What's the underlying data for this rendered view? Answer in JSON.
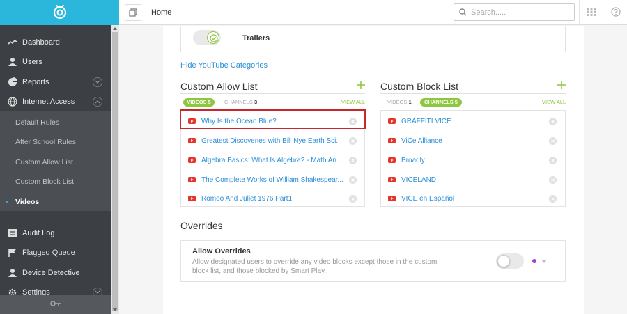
{
  "topbar": {
    "breadcrumb": "Home",
    "search_placeholder": "Search....."
  },
  "sidebar": {
    "items": [
      {
        "label": "Dashboard",
        "icon": "chart-line-icon"
      },
      {
        "label": "Users",
        "icon": "user-icon"
      },
      {
        "label": "Reports",
        "icon": "pie-chart-icon"
      },
      {
        "label": "Internet Access",
        "icon": "globe-icon"
      }
    ],
    "subitems": [
      {
        "label": "Default Rules"
      },
      {
        "label": "After School Rules"
      },
      {
        "label": "Custom Allow List"
      },
      {
        "label": "Custom Block List"
      },
      {
        "label": "Videos"
      }
    ],
    "items_bottom": [
      {
        "label": "Audit Log",
        "icon": "list-icon"
      },
      {
        "label": "Flagged Queue",
        "icon": "flag-icon"
      },
      {
        "label": "Device Detective",
        "icon": "user-icon"
      },
      {
        "label": "Settings",
        "icon": "gear-icon"
      }
    ]
  },
  "trailers": {
    "label": "Trailers"
  },
  "hide_categories": "Hide YouTube Categories",
  "allow_list": {
    "title": "Custom Allow List",
    "tab_videos_label": "VIDEOS",
    "tab_videos_count": "5",
    "tab_channels_label": "CHANNELS",
    "tab_channels_count": "3",
    "view_all": "VIEW ALL",
    "items": [
      "Why Is the Ocean Blue?",
      "Greatest Discoveries with Bill Nye Earth Sci...",
      "Algebra Basics: What Is Algebra? - Math An...",
      "The Complete Works of William Shakespear...",
      "Romeo And Juliet 1976 Part1"
    ]
  },
  "block_list": {
    "title": "Custom Block List",
    "tab_videos_label": "VIDEOS",
    "tab_videos_count": "1",
    "tab_channels_label": "CHANNELS",
    "tab_channels_count": "5",
    "view_all": "VIEW ALL",
    "items": [
      "GRAFFITI VICE",
      "ViCe Alliance",
      "Broadly",
      "VICELAND",
      "VICE en Español"
    ]
  },
  "overrides": {
    "title": "Overrides",
    "allow_title": "Allow Overrides",
    "description": "Allow designated users to override any video blocks except those in the custom block list, and those blocked by Smart Play."
  },
  "colors": {
    "brand": "#2bb6dc",
    "accent_green": "#8dc63f",
    "link_blue": "#2b8fd6",
    "highlight_red": "#c8282d",
    "youtube_red": "#e5352c"
  }
}
